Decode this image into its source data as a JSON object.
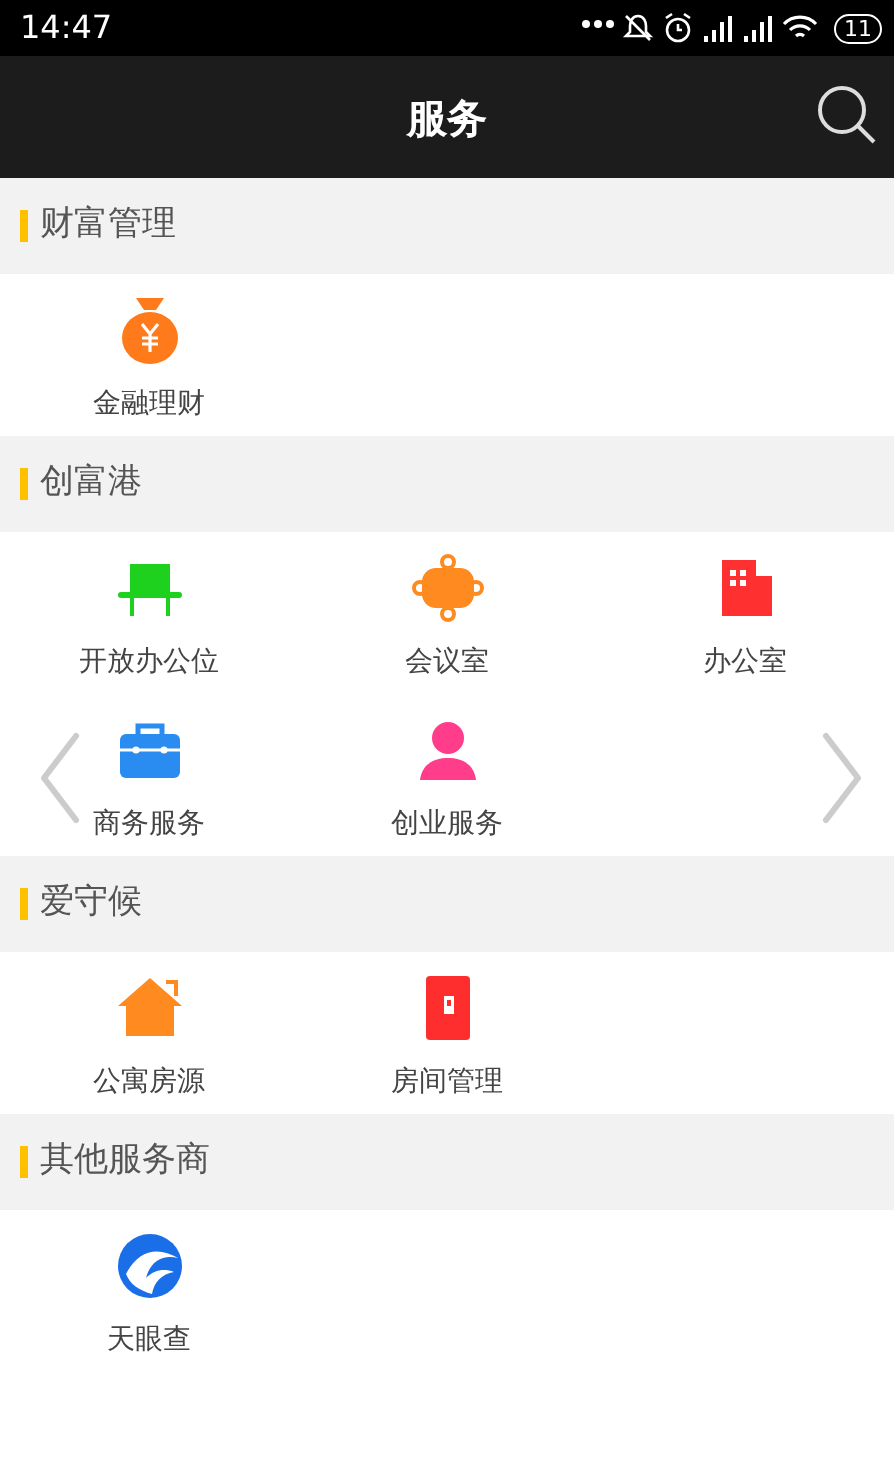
{
  "status_bar": {
    "time": "14:47",
    "battery": "11"
  },
  "app_bar": {
    "title": "服务"
  },
  "sections": [
    {
      "title": "财富管理",
      "items": [
        {
          "label": "金融理财"
        }
      ]
    },
    {
      "title": "创富港",
      "carousel": true,
      "items": [
        {
          "label": "开放办公位"
        },
        {
          "label": "会议室"
        },
        {
          "label": "办公室"
        },
        {
          "label": "商务服务"
        },
        {
          "label": "创业服务"
        }
      ]
    },
    {
      "title": "爱守候",
      "items": [
        {
          "label": "公寓房源"
        },
        {
          "label": "房间管理"
        }
      ]
    },
    {
      "title": "其他服务商",
      "items": [
        {
          "label": "天眼查"
        }
      ]
    }
  ]
}
